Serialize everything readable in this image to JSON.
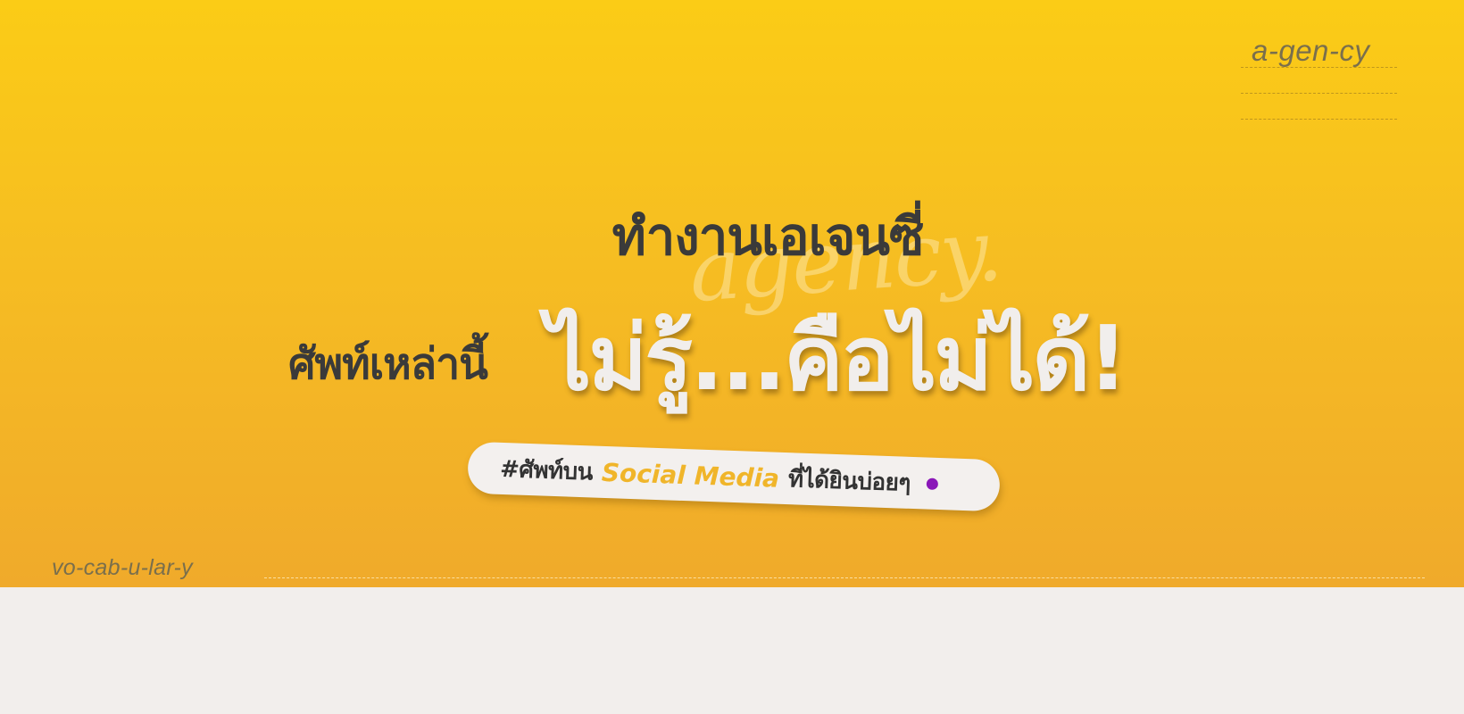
{
  "banner": {
    "tag_top": "a-gen-cy",
    "tag_bottom": "vo-cab-u-lar-y",
    "watermark": "agency.",
    "headline_line1": "ทำงานเอเจนซี่",
    "headline_line2_small": "ศัพท์เหล่านี้",
    "headline_line2_big": "ไม่รู้...คือไม่ได้!",
    "pill": {
      "prefix": "#ศัพท์บน",
      "accent": "Social Media",
      "suffix": "ที่ได้ยินบ่อยๆ"
    }
  },
  "colors": {
    "banner_top": "#fbcc16",
    "banner_bottom": "#f0aa2b",
    "headline_dark": "#3a3a3a",
    "headline_light": "#f1eeec",
    "accent_yellow": "#f0b52a",
    "dot_purple": "#8a17b8",
    "panel_bg": "#f2eeec"
  }
}
